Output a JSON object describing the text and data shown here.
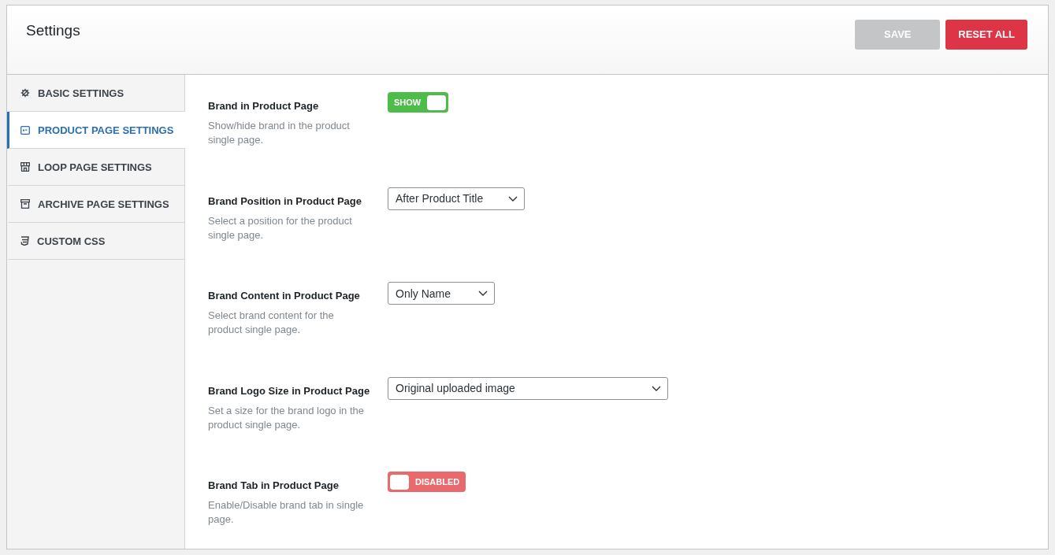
{
  "header": {
    "title": "Settings",
    "buttons": [
      {
        "label": "SAVE",
        "kind": "save",
        "disabled": true
      },
      {
        "label": "RESET ALL",
        "kind": "reset",
        "disabled": false
      }
    ]
  },
  "sidebar": {
    "items": [
      {
        "label": "BASIC SETTINGS",
        "selected": false
      },
      {
        "label": "PRODUCT PAGE SETTINGS",
        "selected": true
      },
      {
        "label": "LOOP PAGE SETTINGS",
        "selected": false
      },
      {
        "label": "ARCHIVE PAGE SETTINGS",
        "selected": false
      },
      {
        "label": "CUSTOM CSS",
        "selected": false
      }
    ]
  },
  "settings": [
    {
      "kind": "toggle",
      "label": "Brand in Product Page",
      "description": "Show/hide brand in the product single page.",
      "on": true,
      "text": "SHOW"
    },
    {
      "kind": "select",
      "label": "Brand Position in Product Page",
      "description": "Select a position for the product single page.",
      "value": "After Product Title"
    },
    {
      "kind": "select",
      "label": "Brand Content in Product Page",
      "description": "Select brand content for the product single page.",
      "value": "Only Name"
    },
    {
      "kind": "select",
      "label": "Brand Logo Size in Product Page",
      "description": "Set a size for the brand logo in the product single page.",
      "value": "Original uploaded image"
    },
    {
      "kind": "toggle",
      "label": "Brand Tab in Product Page",
      "description": "Enable/Disable brand tab in single page.",
      "on": false,
      "text": "DISABLED"
    }
  ]
}
